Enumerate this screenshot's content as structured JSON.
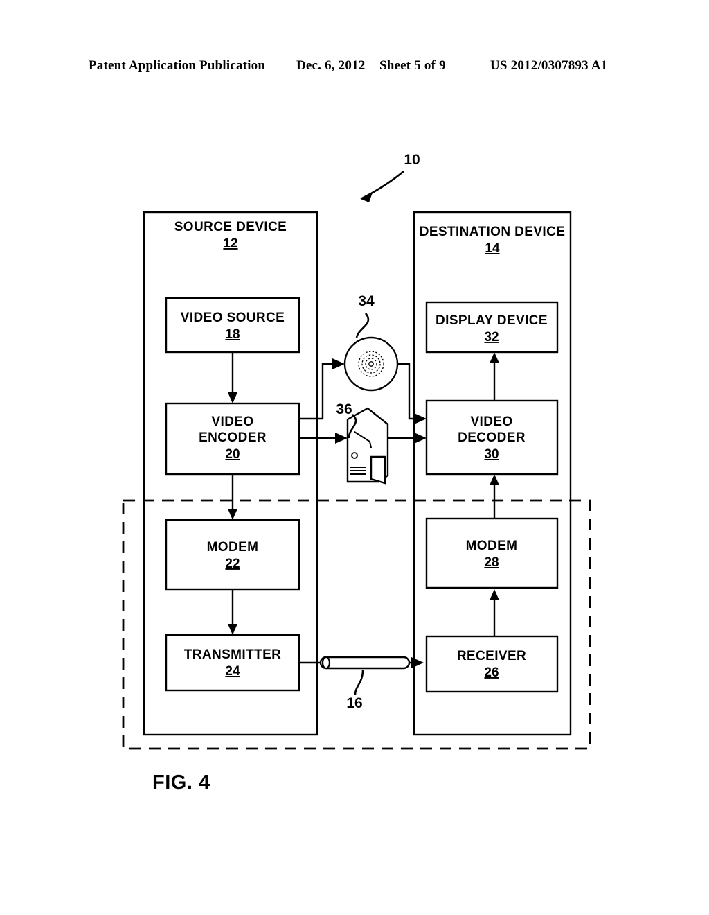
{
  "header": {
    "publication": "Patent Application Publication",
    "date": "Dec. 6, 2012",
    "sheet": "Sheet 5 of 9",
    "patent_number": "US 2012/0307893 A1"
  },
  "figure": {
    "caption": "FIG. 4",
    "system_callout": "10"
  },
  "source_device": {
    "title": "SOURCE DEVICE",
    "ref": "12",
    "blocks": [
      {
        "title": "VIDEO SOURCE",
        "ref": "18"
      },
      {
        "title_line1": "VIDEO",
        "title_line2": "ENCODER",
        "ref": "20"
      },
      {
        "title": "MODEM",
        "ref": "22"
      },
      {
        "title": "TRANSMITTER",
        "ref": "24"
      }
    ]
  },
  "destination_device": {
    "title": "DESTINATION DEVICE",
    "ref": "14",
    "blocks": [
      {
        "title": "DISPLAY DEVICE",
        "ref": "32"
      },
      {
        "title_line1": "VIDEO",
        "title_line2": "DECODER",
        "ref": "30"
      },
      {
        "title": "MODEM",
        "ref": "28"
      },
      {
        "title": "RECEIVER",
        "ref": "26"
      }
    ]
  },
  "media": [
    {
      "name": "storage-disc-icon",
      "callout": "34"
    },
    {
      "name": "computer-server-icon",
      "callout": "36"
    }
  ],
  "channel": {
    "name": "communication-channel-cable",
    "callout": "16"
  },
  "colors": {
    "ink": "#000000",
    "paper": "#ffffff"
  }
}
